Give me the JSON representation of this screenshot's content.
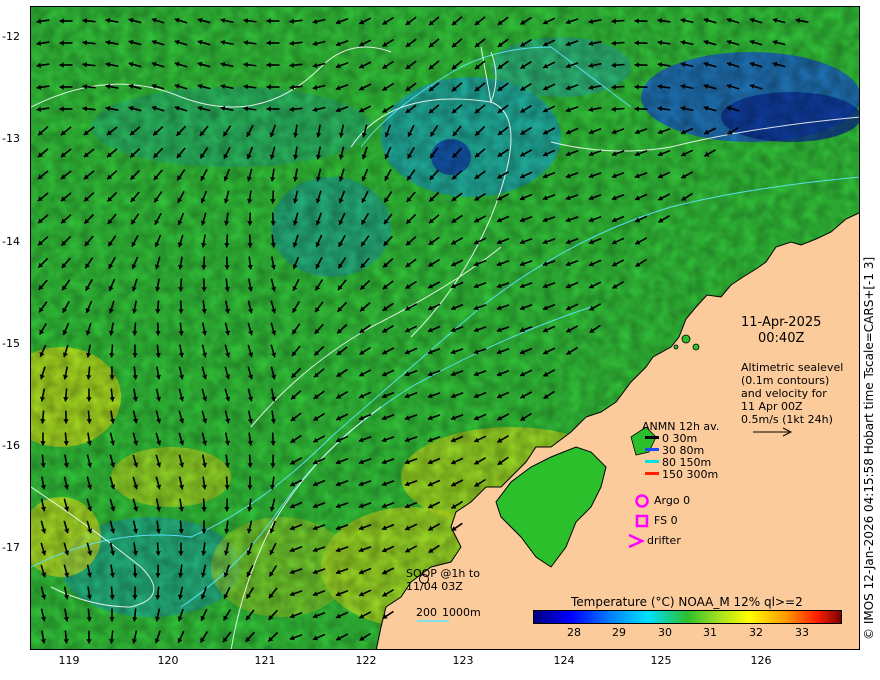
{
  "axes": {
    "lat_labels": [
      "-12",
      "-13",
      "-14",
      "-15",
      "-16",
      "-17"
    ],
    "lon_labels": [
      "119",
      "120",
      "121",
      "122",
      "123",
      "124",
      "125",
      "126"
    ]
  },
  "side_text": "© IMOS 12-Jan-2026 04:15:58 Hobart time Tscale=CARS+[-1 3]",
  "info": {
    "date": "11-Apr-2025",
    "time": "00:40Z",
    "desc_lines": [
      "Altimetric sealevel",
      "(0.1m contours)",
      "and velocity for",
      "11 Apr 00Z",
      "0.5m/s (1kt 24h)"
    ]
  },
  "anmn_legend": {
    "title": "ANMN 12h av.",
    "items": [
      {
        "label": "0 30m",
        "color": "#000000"
      },
      {
        "label": "30 80m",
        "color": "#1a4cff"
      },
      {
        "label": "80 150m",
        "color": "#00e0e0"
      },
      {
        "label": "150 300m",
        "color": "#ff2000"
      }
    ]
  },
  "markers": {
    "argo": "Argo 0",
    "fs": "FS 0",
    "drifter": "drifter",
    "soop_line1": "SOOP @1h to",
    "soop_line2": "11/04 03Z"
  },
  "depth_legend": {
    "d200": "200",
    "d1000": "1000m"
  },
  "colorbar": {
    "title": "Temperature (°C) NOAA_M 12% ql>=2",
    "ticks": [
      "28",
      "29",
      "30",
      "31",
      "32",
      "33"
    ]
  },
  "colors": {
    "land": "#fccb9c",
    "ocean_main": "#2cbf2c",
    "argo": "#ff00ff"
  }
}
